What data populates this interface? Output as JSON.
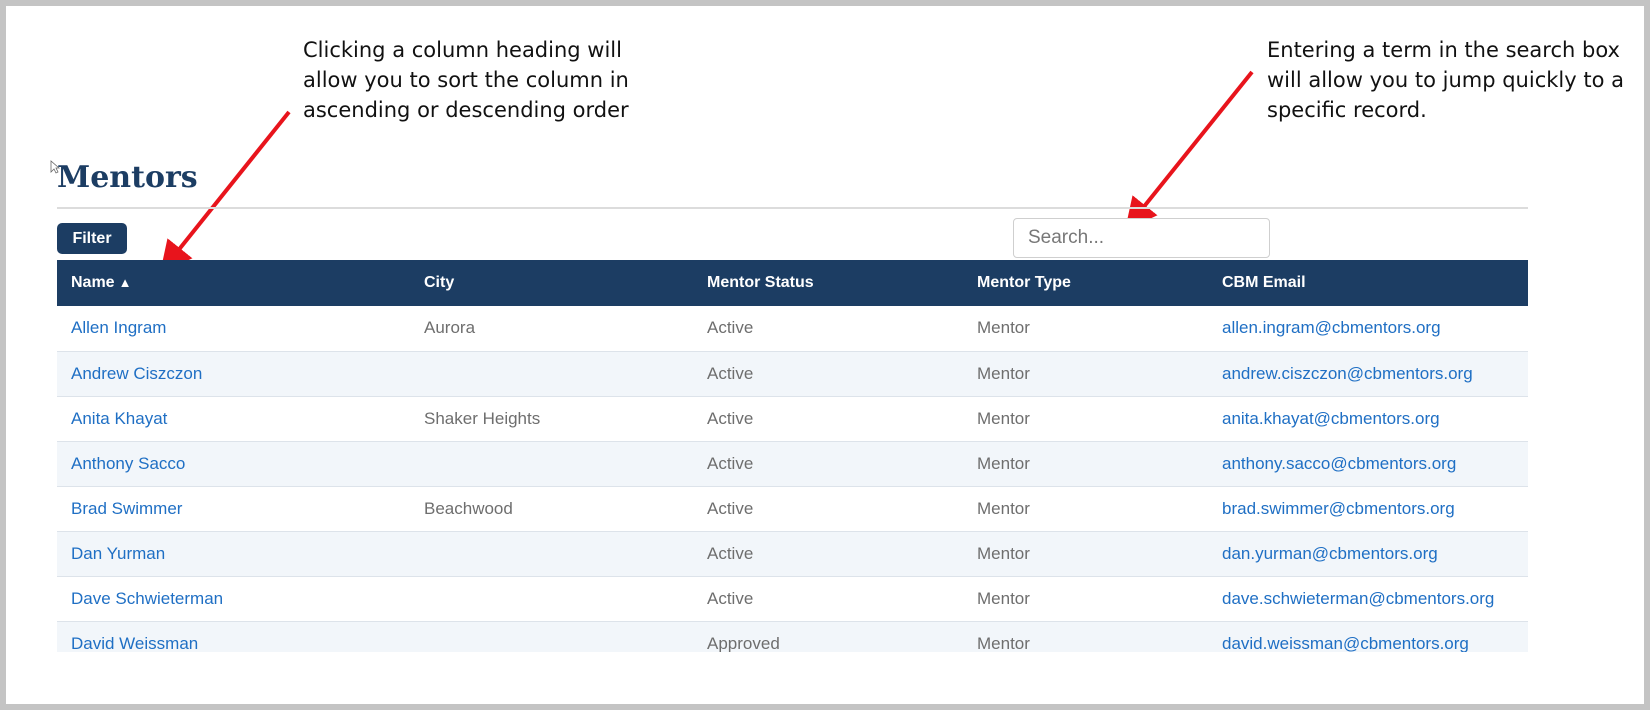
{
  "annotations": {
    "left": "Clicking a column heading will allow you to sort the column in ascending or descending order",
    "right": "Entering a term in the search box will allow you to jump quickly to a specific record."
  },
  "page": {
    "title": "Mentors"
  },
  "toolbar": {
    "filter_label": "Filter",
    "search_placeholder": "Search..."
  },
  "table": {
    "columns": [
      "Name",
      "City",
      "Mentor Status",
      "Mentor Type",
      "CBM Email"
    ],
    "sort_indicator": "▲",
    "rows": [
      {
        "name": "Allen Ingram",
        "city": "Aurora",
        "status": "Active",
        "type": "Mentor",
        "email": "allen.ingram@cbmentors.org"
      },
      {
        "name": "Andrew Ciszczon",
        "city": "",
        "status": "Active",
        "type": "Mentor",
        "email": "andrew.ciszczon@cbmentors.org"
      },
      {
        "name": "Anita Khayat",
        "city": "Shaker Heights",
        "status": "Active",
        "type": "Mentor",
        "email": "anita.khayat@cbmentors.org"
      },
      {
        "name": "Anthony Sacco",
        "city": "",
        "status": "Active",
        "type": "Mentor",
        "email": "anthony.sacco@cbmentors.org"
      },
      {
        "name": "Brad Swimmer",
        "city": "Beachwood",
        "status": "Active",
        "type": "Mentor",
        "email": "brad.swimmer@cbmentors.org"
      },
      {
        "name": "Dan Yurman",
        "city": "",
        "status": "Active",
        "type": "Mentor",
        "email": "dan.yurman@cbmentors.org"
      },
      {
        "name": "Dave Schwieterman",
        "city": "",
        "status": "Active",
        "type": "Mentor",
        "email": "dave.schwieterman@cbmentors.org"
      },
      {
        "name": "David Weissman",
        "city": "",
        "status": "Approved",
        "type": "Mentor",
        "email": "david.weissman@cbmentors.org"
      }
    ]
  },
  "colors": {
    "brand_navy": "#1c3d63",
    "link_blue": "#1f6fc4",
    "annotation_arrow": "#e8141c",
    "row_stripe": "#f2f6fa"
  },
  "icons": {
    "sort": "sort-ascending-icon",
    "cursor": "cursor-icon"
  }
}
